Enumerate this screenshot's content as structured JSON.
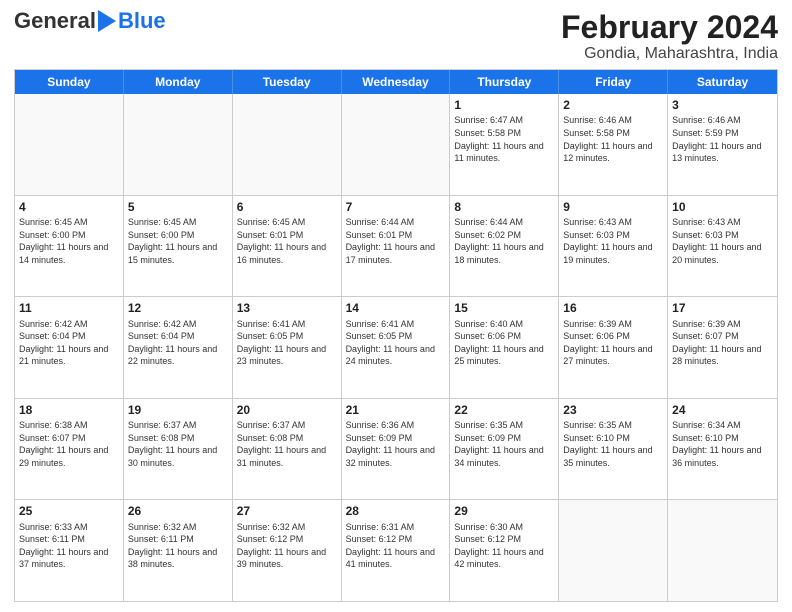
{
  "logo": {
    "general": "General",
    "blue": "Blue"
  },
  "title": "February 2024",
  "subtitle": "Gondia, Maharashtra, India",
  "weekdays": [
    "Sunday",
    "Monday",
    "Tuesday",
    "Wednesday",
    "Thursday",
    "Friday",
    "Saturday"
  ],
  "weeks": [
    [
      {
        "day": "",
        "info": ""
      },
      {
        "day": "",
        "info": ""
      },
      {
        "day": "",
        "info": ""
      },
      {
        "day": "",
        "info": ""
      },
      {
        "day": "1",
        "info": "Sunrise: 6:47 AM\nSunset: 5:58 PM\nDaylight: 11 hours and 11 minutes."
      },
      {
        "day": "2",
        "info": "Sunrise: 6:46 AM\nSunset: 5:58 PM\nDaylight: 11 hours and 12 minutes."
      },
      {
        "day": "3",
        "info": "Sunrise: 6:46 AM\nSunset: 5:59 PM\nDaylight: 11 hours and 13 minutes."
      }
    ],
    [
      {
        "day": "4",
        "info": "Sunrise: 6:45 AM\nSunset: 6:00 PM\nDaylight: 11 hours and 14 minutes."
      },
      {
        "day": "5",
        "info": "Sunrise: 6:45 AM\nSunset: 6:00 PM\nDaylight: 11 hours and 15 minutes."
      },
      {
        "day": "6",
        "info": "Sunrise: 6:45 AM\nSunset: 6:01 PM\nDaylight: 11 hours and 16 minutes."
      },
      {
        "day": "7",
        "info": "Sunrise: 6:44 AM\nSunset: 6:01 PM\nDaylight: 11 hours and 17 minutes."
      },
      {
        "day": "8",
        "info": "Sunrise: 6:44 AM\nSunset: 6:02 PM\nDaylight: 11 hours and 18 minutes."
      },
      {
        "day": "9",
        "info": "Sunrise: 6:43 AM\nSunset: 6:03 PM\nDaylight: 11 hours and 19 minutes."
      },
      {
        "day": "10",
        "info": "Sunrise: 6:43 AM\nSunset: 6:03 PM\nDaylight: 11 hours and 20 minutes."
      }
    ],
    [
      {
        "day": "11",
        "info": "Sunrise: 6:42 AM\nSunset: 6:04 PM\nDaylight: 11 hours and 21 minutes."
      },
      {
        "day": "12",
        "info": "Sunrise: 6:42 AM\nSunset: 6:04 PM\nDaylight: 11 hours and 22 minutes."
      },
      {
        "day": "13",
        "info": "Sunrise: 6:41 AM\nSunset: 6:05 PM\nDaylight: 11 hours and 23 minutes."
      },
      {
        "day": "14",
        "info": "Sunrise: 6:41 AM\nSunset: 6:05 PM\nDaylight: 11 hours and 24 minutes."
      },
      {
        "day": "15",
        "info": "Sunrise: 6:40 AM\nSunset: 6:06 PM\nDaylight: 11 hours and 25 minutes."
      },
      {
        "day": "16",
        "info": "Sunrise: 6:39 AM\nSunset: 6:06 PM\nDaylight: 11 hours and 27 minutes."
      },
      {
        "day": "17",
        "info": "Sunrise: 6:39 AM\nSunset: 6:07 PM\nDaylight: 11 hours and 28 minutes."
      }
    ],
    [
      {
        "day": "18",
        "info": "Sunrise: 6:38 AM\nSunset: 6:07 PM\nDaylight: 11 hours and 29 minutes."
      },
      {
        "day": "19",
        "info": "Sunrise: 6:37 AM\nSunset: 6:08 PM\nDaylight: 11 hours and 30 minutes."
      },
      {
        "day": "20",
        "info": "Sunrise: 6:37 AM\nSunset: 6:08 PM\nDaylight: 11 hours and 31 minutes."
      },
      {
        "day": "21",
        "info": "Sunrise: 6:36 AM\nSunset: 6:09 PM\nDaylight: 11 hours and 32 minutes."
      },
      {
        "day": "22",
        "info": "Sunrise: 6:35 AM\nSunset: 6:09 PM\nDaylight: 11 hours and 34 minutes."
      },
      {
        "day": "23",
        "info": "Sunrise: 6:35 AM\nSunset: 6:10 PM\nDaylight: 11 hours and 35 minutes."
      },
      {
        "day": "24",
        "info": "Sunrise: 6:34 AM\nSunset: 6:10 PM\nDaylight: 11 hours and 36 minutes."
      }
    ],
    [
      {
        "day": "25",
        "info": "Sunrise: 6:33 AM\nSunset: 6:11 PM\nDaylight: 11 hours and 37 minutes."
      },
      {
        "day": "26",
        "info": "Sunrise: 6:32 AM\nSunset: 6:11 PM\nDaylight: 11 hours and 38 minutes."
      },
      {
        "day": "27",
        "info": "Sunrise: 6:32 AM\nSunset: 6:12 PM\nDaylight: 11 hours and 39 minutes."
      },
      {
        "day": "28",
        "info": "Sunrise: 6:31 AM\nSunset: 6:12 PM\nDaylight: 11 hours and 41 minutes."
      },
      {
        "day": "29",
        "info": "Sunrise: 6:30 AM\nSunset: 6:12 PM\nDaylight: 11 hours and 42 minutes."
      },
      {
        "day": "",
        "info": ""
      },
      {
        "day": "",
        "info": ""
      }
    ]
  ]
}
